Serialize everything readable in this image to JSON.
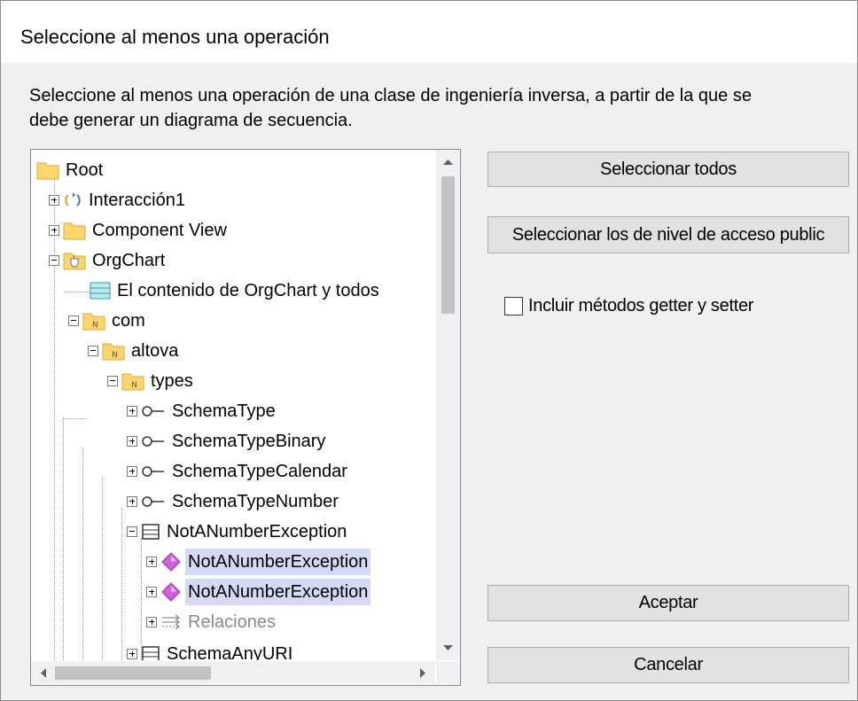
{
  "dialog": {
    "title": "Seleccione al menos una operación",
    "instructions": "Seleccione al menos una operación de una clase de ingeniería inversa, a partir de la que se debe generar un diagrama de secuencia."
  },
  "tree": {
    "nodes": [
      {
        "label": "Root",
        "icon": "folder-icon"
      },
      {
        "label": "Interacción1",
        "icon": "interaction-icon"
      },
      {
        "label": "Component View",
        "icon": "folder-icon"
      },
      {
        "label": "OrgChart",
        "icon": "java-package-icon"
      },
      {
        "label": "El contenido de OrgChart y todos",
        "icon": "diagram-icon"
      },
      {
        "label": "com",
        "icon": "namespace-folder-icon"
      },
      {
        "label": "altova",
        "icon": "namespace-folder-icon"
      },
      {
        "label": "types",
        "icon": "namespace-folder-icon"
      },
      {
        "label": "SchemaType",
        "icon": "interface-icon"
      },
      {
        "label": "SchemaTypeBinary",
        "icon": "interface-icon"
      },
      {
        "label": "SchemaTypeCalendar",
        "icon": "interface-icon"
      },
      {
        "label": "SchemaTypeNumber",
        "icon": "interface-icon"
      },
      {
        "label": "NotANumberException",
        "icon": "class-icon"
      },
      {
        "label": "NotANumberException",
        "icon": "operation-icon"
      },
      {
        "label": "NotANumberException",
        "icon": "operation-icon"
      },
      {
        "label": "Relaciones",
        "icon": "relations-icon"
      },
      {
        "label": "SchemaAnyURI",
        "icon": "class-icon"
      }
    ]
  },
  "buttons": {
    "select_all": "Seleccionar todos",
    "select_public": "Seleccionar los de nivel de acceso public",
    "ok": "Aceptar",
    "cancel": "Cancelar"
  },
  "checkbox": {
    "label": "Incluir métodos getter y setter",
    "checked": false
  },
  "colors": {
    "selection": "#d6d9f5",
    "folder": "#fcd66a",
    "operation": "#d35fe0"
  }
}
